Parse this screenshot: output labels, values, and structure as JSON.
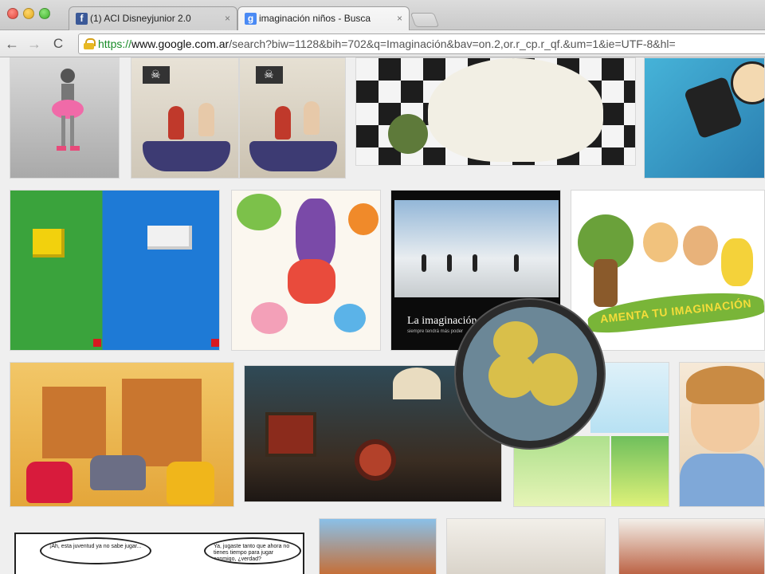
{
  "browser": {
    "tabs": [
      {
        "label": "(1) ACI Disneyjunior 2.0",
        "icon": "facebook-icon",
        "active": false
      },
      {
        "label": "imaginación niños - Busca",
        "icon": "google-icon",
        "active": true
      }
    ],
    "close_glyph": "×",
    "address": {
      "protocol": "https://",
      "host": "www.google.com.ar",
      "path": "/search?biw=1128&bih=702&q=Imaginación&bav=on.2,or.r_cp.r_qf.&um=1&ie=UTF-8&hl="
    },
    "nav": {
      "back": "←",
      "forward": "→",
      "reload": "C"
    }
  },
  "results": {
    "poster_text": "La imaginación",
    "poster_subtext": "siempre tendrá más poder",
    "banner_text": "AMENTA TU IMAGINACIÓN",
    "comic_left": "¡Ah, esta juventud ya no sabe jugar...",
    "comic_right": "Ya, jugaste tanto que ahora no tienes tiempo para jugar conmigo, ¿verdad?"
  },
  "colors": {
    "green_url": "#1a8d2a",
    "badge_bg": "#6b8797",
    "badge_ball": "#d9bf4a"
  }
}
